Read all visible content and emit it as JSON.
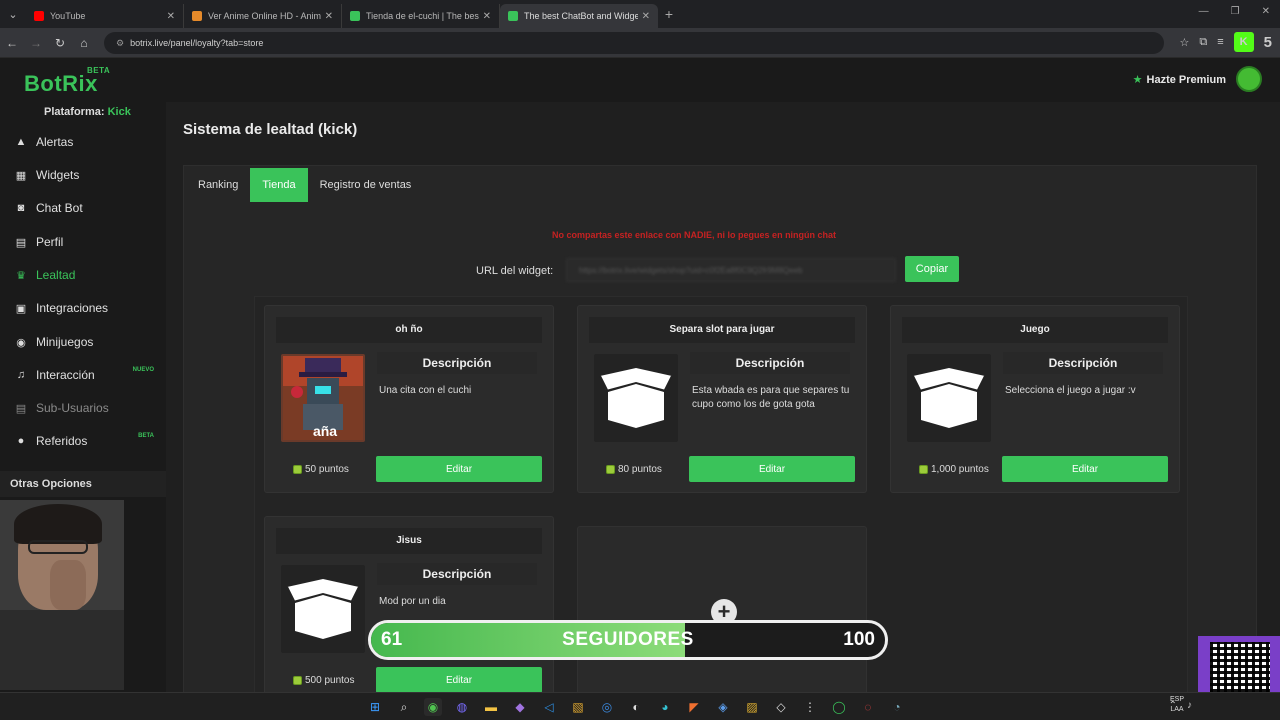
{
  "browser": {
    "tabs": [
      {
        "title": "YouTube",
        "color": "#ff0000"
      },
      {
        "title": "Ver Anime Online HD - AnimeFLV",
        "color": "#e58a2a"
      },
      {
        "title": "Tienda de el-cuchi | The best",
        "color": "#3ac35a"
      },
      {
        "title": "The best ChatBot and Widgets",
        "color": "#3ac35a"
      }
    ],
    "url": "botrix.live/panel/loyalty?tab=store",
    "ext_label": "5"
  },
  "app": {
    "logo": "BotRix",
    "logo_badge": "BETA",
    "premium": "Hazte Premium",
    "platform_label": "Plataforma:",
    "platform_value": "Kick"
  },
  "sidebar": {
    "items": [
      {
        "label": "Alertas",
        "icon": "warning-icon"
      },
      {
        "label": "Widgets",
        "icon": "grid-icon"
      },
      {
        "label": "Chat Bot",
        "icon": "robot-icon"
      },
      {
        "label": "Perfil",
        "icon": "id-card-icon"
      },
      {
        "label": "Lealtad",
        "icon": "trophy-icon"
      },
      {
        "label": "Integraciones",
        "icon": "plug-icon"
      },
      {
        "label": "Minijuegos",
        "icon": "gamepad-icon"
      },
      {
        "label": "Interacción",
        "icon": "music-icon",
        "badge": "NUEVO"
      },
      {
        "label": "Sub-Usuarios",
        "icon": "users-icon"
      },
      {
        "label": "Referidos",
        "icon": "people-icon",
        "badge": "BETA"
      }
    ],
    "other": "Otras Opciones"
  },
  "main": {
    "title": "Sistema de lealtad (kick)",
    "tabs": [
      "Ranking",
      "Tienda",
      "Registro de ventas"
    ],
    "warning": "No compartas este enlace con NADIE, ni lo pegues en ningún chat",
    "url_label": "URL del widget:",
    "url_value": "https://botrix.live/widgets/shop?uid=c0f2Ea8f0C9Q2fr9M8Qeeb",
    "copy": "Copiar",
    "desc_title": "Descripción",
    "edit": "Editar",
    "cards": [
      {
        "title": "oh ño",
        "desc": "Una cita con el cuchi",
        "points": "50 puntos",
        "img_text": "aña"
      },
      {
        "title": "Separa slot para jugar",
        "desc": "Esta wbada es para que separes tu cupo como los de gota gota",
        "points": "80 puntos"
      },
      {
        "title": "Juego",
        "desc": "Selecciona el juego a jugar :v",
        "points": "1,000 puntos"
      },
      {
        "title": "Jisus",
        "desc": "Mod por un dia",
        "points": "500 puntos"
      }
    ]
  },
  "overlay": {
    "current": "61",
    "label": "SEGUIDORES",
    "goal": "100",
    "progress": 0.61
  },
  "taskbar": {
    "lang1": "ESP",
    "lang2": "LAA"
  }
}
